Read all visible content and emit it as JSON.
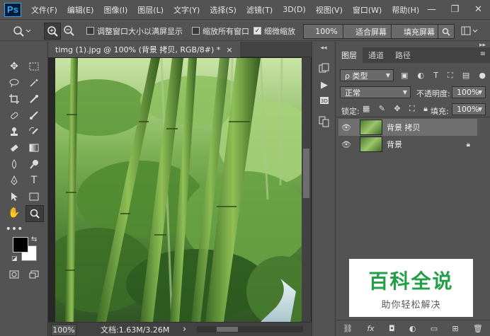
{
  "app": {
    "logo": "Ps",
    "menu": [
      "文件(F)",
      "编辑(E)",
      "图像(I)",
      "图层(L)",
      "文字(Y)",
      "选择(S)",
      "滤镜(T)",
      "3D(D)",
      "视图(V)",
      "窗口(W)",
      "帮助(H)"
    ],
    "window_controls": [
      "minimize-icon",
      "restore-icon",
      "close-icon"
    ]
  },
  "options": {
    "resize_windows_label": "调整窗口大小以满屏显示",
    "resize_windows_checked": false,
    "zoom_all_label": "缩放所有窗口",
    "zoom_all_checked": false,
    "scrubby_zoom_label": "细微缩放",
    "scrubby_zoom_checked": true,
    "zoom_value": "100%",
    "fit_screen_label": "适合屏幕",
    "fill_screen_label": "填充屏幕"
  },
  "document": {
    "tab_title": "timg (1).jpg @ 100% (背景 拷贝, RGB/8#) *",
    "close_glyph": "×",
    "status_zoom": "100%",
    "status_doc": "文档:1.63M/3.26M",
    "status_arrow": "›"
  },
  "layers_panel": {
    "tabs": [
      "图层",
      "通道",
      "路径"
    ],
    "active_tab": 0,
    "filter_label": "ρ 类型",
    "blend_mode": "正常",
    "opacity_label": "不透明度:",
    "opacity_value": "100%",
    "lock_label": "锁定:",
    "fill_label": "填充:",
    "fill_value": "100%",
    "layers": [
      {
        "name": "背景 拷贝",
        "visible": true,
        "selected": true,
        "locked": false
      },
      {
        "name": "背景",
        "visible": true,
        "selected": false,
        "locked": true
      }
    ],
    "footer_icons": [
      "link-icon",
      "fx-icon",
      "mask-icon",
      "adjustment-icon",
      "group-icon",
      "new-layer-icon",
      "trash-icon"
    ]
  },
  "watermark": {
    "title": "百科全说",
    "subtitle": "助你轻松解决"
  },
  "colors": {
    "ui_bg": "#535353",
    "panel_dark": "#424242",
    "watermark_green": "#22a047",
    "foreground": "#000000",
    "background": "#ffffff"
  }
}
